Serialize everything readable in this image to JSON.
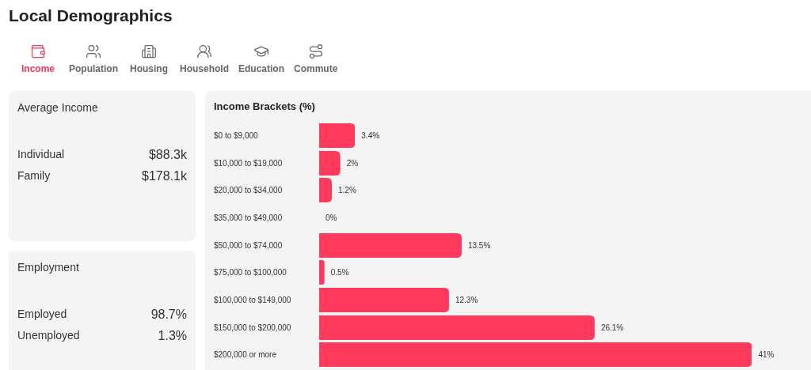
{
  "title": "Local Demographics",
  "tabs": [
    {
      "label": "Income",
      "selected": true
    },
    {
      "label": "Population",
      "selected": false
    },
    {
      "label": "Housing",
      "selected": false
    },
    {
      "label": "Household",
      "selected": false
    },
    {
      "label": "Education",
      "selected": false
    },
    {
      "label": "Commute",
      "selected": false
    }
  ],
  "cards": [
    {
      "title": "Average Income",
      "rows": [
        {
          "label": "Individual",
          "value": "$88.3k"
        },
        {
          "label": "Family",
          "value": "$178.1k"
        }
      ]
    },
    {
      "title": "Employment",
      "rows": [
        {
          "label": "Employed",
          "value": "98.7%"
        },
        {
          "label": "Unemployed",
          "value": "1.3%"
        }
      ]
    }
  ],
  "chart": {
    "chart_data": {
      "type": "bar",
      "orientation": "horizontal",
      "title": "Income Brackets (%)",
      "data_labels": true,
      "categories": [
        "$0 to $9,000",
        "$10,000 to $19,000",
        "$20,000 to $34,000",
        "$35,000 to $49,000",
        "$50,000 to $74,000",
        "$75,000 to $100,000",
        "$100,000 to $149,000",
        "$150,000 to $200,000",
        "$200,000 or more"
      ],
      "series": [
        {
          "color": "#ff3a5c",
          "values": [
            3.4,
            2,
            1.2,
            0,
            13.5,
            0.5,
            12.3,
            26.1,
            41
          ],
          "value_labels": [
            "3.4%",
            "2%",
            "1.2%",
            "0%",
            "13.5%",
            "0.5%",
            "12.3%",
            "26.1%",
            "41%"
          ]
        }
      ]
    }
  }
}
